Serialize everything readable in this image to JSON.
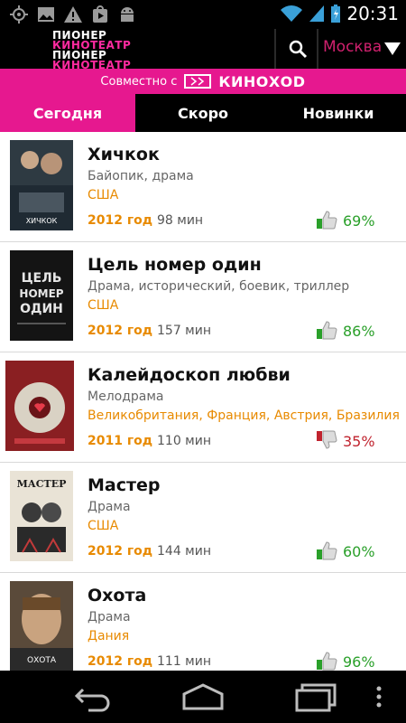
{
  "status_bar": {
    "time": "20:31",
    "left_icons": [
      "gps-icon",
      "image-icon",
      "warning-icon",
      "play-store-icon",
      "android-icon"
    ],
    "right_icons": [
      "wifi-icon",
      "signal-icon",
      "battery-icon"
    ]
  },
  "app_bar": {
    "logo_lines": [
      "ПИОНЕР",
      "КИНОТЕАТР",
      "ПИОНЕР",
      "КИНОТЕАТР"
    ],
    "search_icon": "search-icon",
    "city": "Москва",
    "city_dropdown_icon": "triangle-down-icon"
  },
  "partner": {
    "text": "Совместно с",
    "brand": "КИНОХОD"
  },
  "tabs": [
    {
      "label": "Сегодня",
      "active": true
    },
    {
      "label": "Скоро",
      "active": false
    },
    {
      "label": "Новинки",
      "active": false
    }
  ],
  "movies": [
    {
      "title": "Хичкок",
      "genre": "Байопик, драма",
      "country": "США",
      "year": "2012 год",
      "duration": "98 мин",
      "rating": "69%",
      "sentiment": "good",
      "poster_caption": "ХИЧКОК"
    },
    {
      "title": "Цель номер один",
      "genre": "Драма, исторический, боевик, триллер",
      "country": "США",
      "year": "2012 год",
      "duration": "157 мин",
      "rating": "86%",
      "sentiment": "good",
      "poster_caption": "ЦЕЛЬ НОМЕР ОДИН"
    },
    {
      "title": "Калейдоскоп любви",
      "genre": "Мелодрама",
      "country": "Великобритания, Франция, Австрия, Бразилия",
      "year": "2011 год",
      "duration": "110 мин",
      "rating": "35%",
      "sentiment": "bad",
      "poster_caption": ""
    },
    {
      "title": "Мастер",
      "genre": "Драма",
      "country": "США",
      "year": "2012 год",
      "duration": "144 мин",
      "rating": "60%",
      "sentiment": "good",
      "poster_caption": "МАСТЕР"
    },
    {
      "title": "Охота",
      "genre": "Драма",
      "country": "Дания",
      "year": "2012 год",
      "duration": "111 мин",
      "rating": "96%",
      "sentiment": "good",
      "poster_caption": "ОХОТА"
    }
  ],
  "nav_bar": {
    "icons": [
      "back-icon",
      "home-icon",
      "recent-apps-icon",
      "overflow-menu-icon"
    ]
  },
  "colors": {
    "accent_pink": "#e6188f",
    "orange": "#e88a00",
    "good": "#2aa02a",
    "bad": "#c0232e"
  }
}
